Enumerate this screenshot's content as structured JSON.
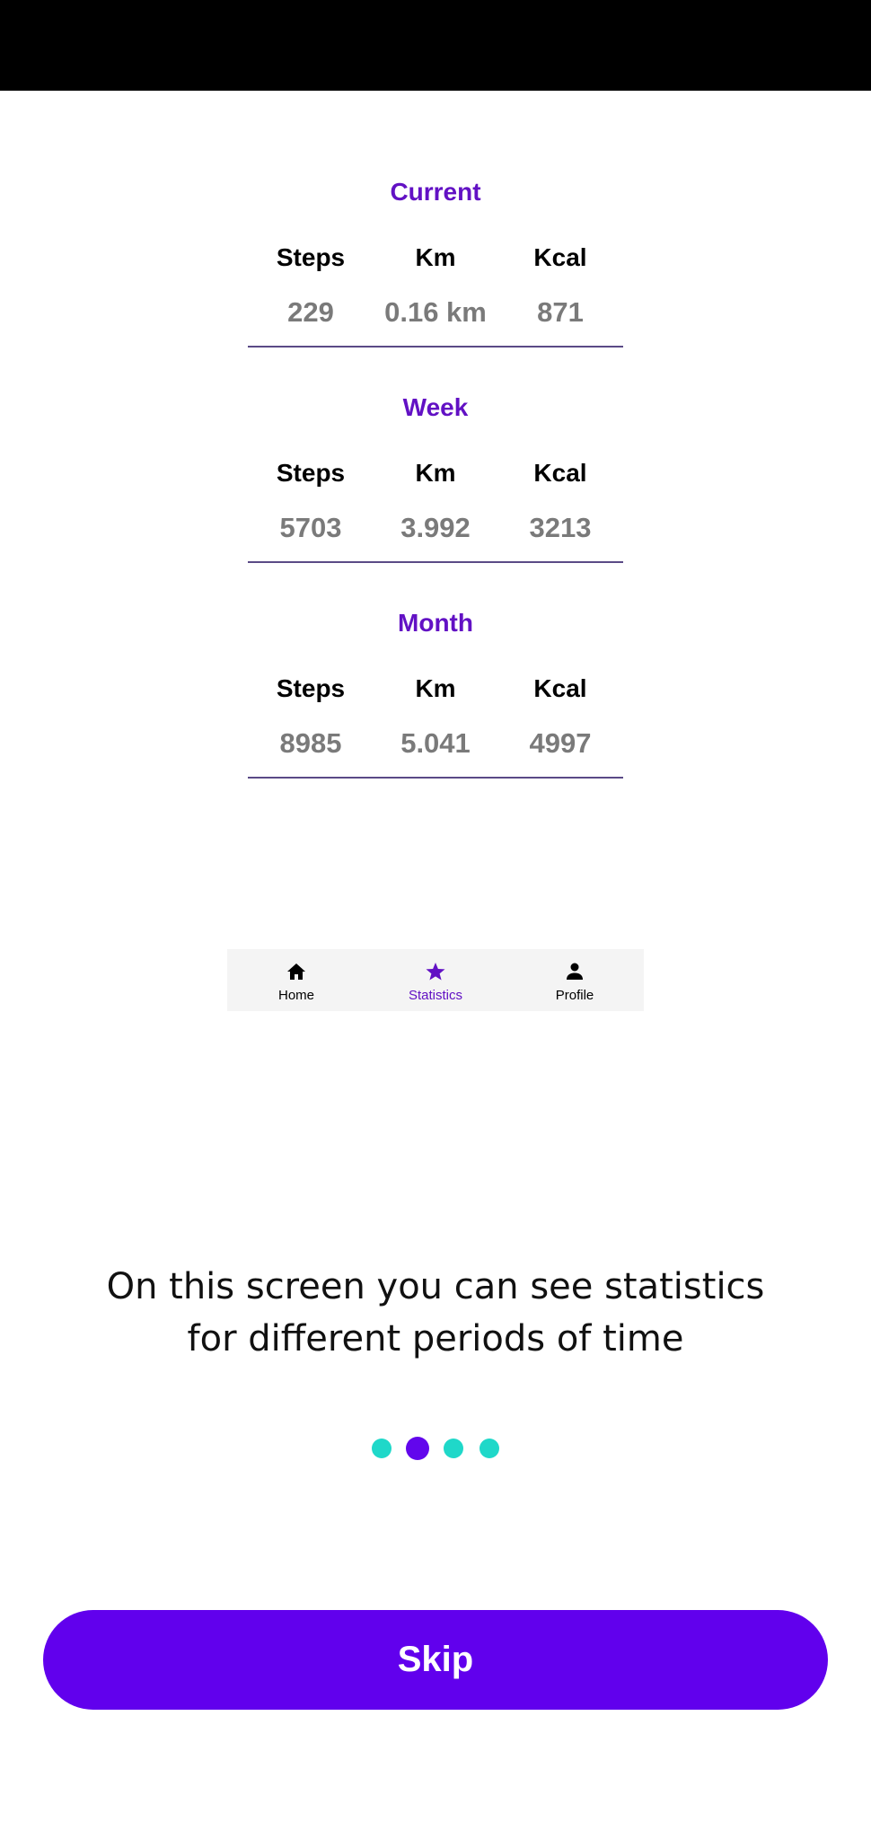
{
  "sections": [
    {
      "title": "Current",
      "columns": [
        {
          "label": "Steps",
          "value": "229"
        },
        {
          "label": "Km",
          "value": "0.16 km"
        },
        {
          "label": "Kcal",
          "value": "871"
        }
      ]
    },
    {
      "title": "Week",
      "columns": [
        {
          "label": "Steps",
          "value": "5703"
        },
        {
          "label": "Km",
          "value": "3.992"
        },
        {
          "label": "Kcal",
          "value": "3213"
        }
      ]
    },
    {
      "title": "Month",
      "columns": [
        {
          "label": "Steps",
          "value": "8985"
        },
        {
          "label": "Km",
          "value": "5.041"
        },
        {
          "label": "Kcal",
          "value": "4997"
        }
      ]
    }
  ],
  "bottom_nav": {
    "items": [
      {
        "label": "Home",
        "icon": "home-icon"
      },
      {
        "label": "Statistics",
        "icon": "star-icon",
        "active": true
      },
      {
        "label": "Profile",
        "icon": "person-icon"
      }
    ]
  },
  "onboarding": {
    "description_line1": "On this screen you can see statistics",
    "description_line2": "for different periods of time",
    "page_indicator": {
      "total": 4,
      "current": 2
    },
    "skip_label": "Skip"
  },
  "colors": {
    "accent": "#6211c4",
    "button": "#6100ed",
    "dot_inactive": "#1fd8c9",
    "dot_active": "#6206ec"
  }
}
